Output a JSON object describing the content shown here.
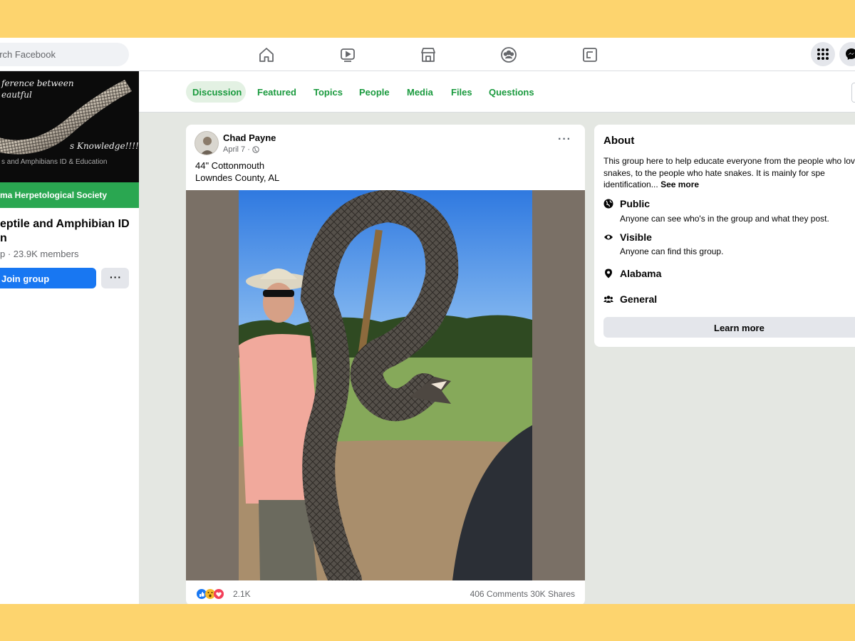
{
  "colors": {
    "frame": "#fdd46e",
    "accent_green": "#1a9a3e",
    "join_blue": "#1877f2",
    "banner_green": "#2aa751"
  },
  "topbar": {
    "search_placeholder": "arch Facebook",
    "nav_icons": [
      "home-icon",
      "watch-icon",
      "marketplace-icon",
      "groups-icon",
      "gaming-icon"
    ],
    "right_icons": [
      "menu-grid-icon",
      "messenger-icon"
    ]
  },
  "group": {
    "cover_line1": "ference between",
    "cover_line2": "eautful",
    "cover_line3": "s Knowledge!!!!",
    "cover_line4": "s and Amphibians ID & Education",
    "banner": "ma Herpetological Society",
    "title": "eptile and Amphibian ID n",
    "meta": "p · 23.9K members",
    "join_label": "Join group",
    "more_label": "···"
  },
  "tabs": [
    {
      "label": "Discussion",
      "active": true
    },
    {
      "label": "Featured",
      "active": false
    },
    {
      "label": "Topics",
      "active": false
    },
    {
      "label": "People",
      "active": false
    },
    {
      "label": "Media",
      "active": false
    },
    {
      "label": "Files",
      "active": false
    },
    {
      "label": "Questions",
      "active": false
    }
  ],
  "post": {
    "author": "Chad Payne",
    "date": "April 7 ·",
    "menu": "···",
    "line1": "44\" Cottonmouth",
    "line2": "Lowndes County, AL",
    "reaction_icons": [
      "like-reaction-icon",
      "wow-reaction-icon",
      "love-reaction-icon"
    ],
    "reaction_count": "2.1K",
    "stats": "406 Comments  30K Shares"
  },
  "about": {
    "title": "About",
    "description": "This group here to help educate everyone from the people who love snakes, to the people who hate snakes. It is mainly for spe identification...",
    "see_more": "See more",
    "rows": [
      {
        "icon": "globe-icon",
        "title": "Public",
        "subtitle": "Anyone can see who's in the group and what they post."
      },
      {
        "icon": "eye-icon",
        "title": "Visible",
        "subtitle": "Anyone can find this group."
      },
      {
        "icon": "location-pin-icon",
        "title": "Alabama",
        "subtitle": ""
      },
      {
        "icon": "people-icon",
        "title": "General",
        "subtitle": ""
      }
    ],
    "learn_more": "Learn more"
  }
}
